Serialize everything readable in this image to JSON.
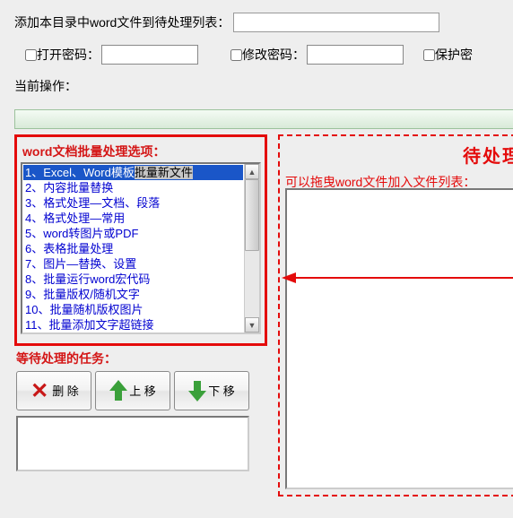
{
  "top": {
    "label": "添加本目录中word文件到待处理列表："
  },
  "pwd": {
    "open_label": "打开密码：",
    "modify_label": "修改密码：",
    "protect_label": "保护密"
  },
  "current_op_label": "当前操作：",
  "options": {
    "title": "word文档批量处理选项：",
    "items": [
      "1、Excel、Word模板批量新文件",
      "2、内容批量替换",
      "3、格式处理—文档、段落",
      "4、格式处理—常用",
      "5、word转图片或PDF",
      "6、表格批量处理",
      "7、图片—替换、设置",
      "8、批量运行word宏代码",
      "9、批量版权/随机文字",
      "10、批量随机版权图片",
      "11、批量添加文字超链接"
    ],
    "selected_index": 0
  },
  "tasks_label": "等待处理的任务：",
  "buttons": {
    "delete": "删\n除",
    "up": "上\n移",
    "down": "下\n移"
  },
  "dropzone": {
    "title": "待处理",
    "subtitle": "可以拖曳word文件加入文件列表："
  }
}
